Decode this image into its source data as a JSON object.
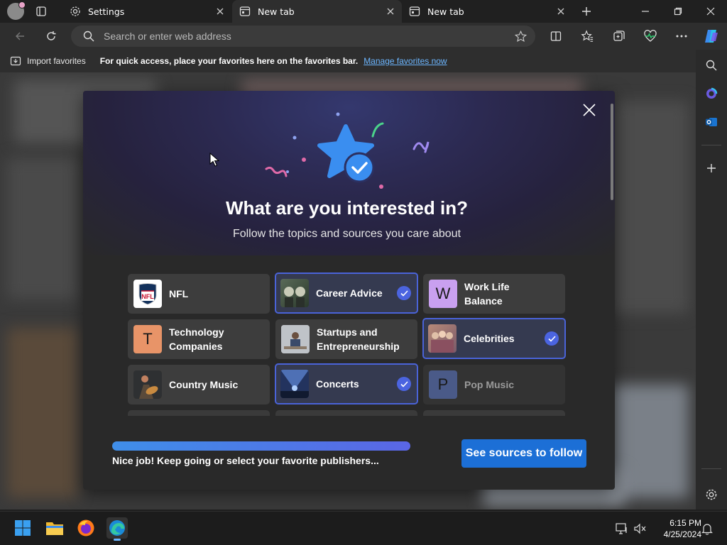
{
  "browser": {
    "tabs": [
      {
        "title": "Settings",
        "icon": "gear-icon",
        "active": false
      },
      {
        "title": "New tab",
        "icon": "newtab-page-icon",
        "active": true
      },
      {
        "title": "New tab",
        "icon": "newtab-page-icon",
        "active": false
      }
    ],
    "address": {
      "placeholder": "Search or enter web address",
      "value": ""
    },
    "favorites_bar": {
      "import_label": "Import favorites",
      "message": "For quick access, place your favorites here on the favorites bar.",
      "link": "Manage favorites now"
    }
  },
  "modal": {
    "title": "What are you interested in?",
    "subtitle": "Follow the topics and sources you care about",
    "topics": [
      {
        "label": "NFL",
        "thumb": "nfl-logo",
        "selected": false
      },
      {
        "label": "Career Advice",
        "thumb": "photo",
        "selected": true
      },
      {
        "label": "Work Life\nBalance",
        "thumb": "W",
        "selected": false
      },
      {
        "label": "Technology\nCompanies",
        "thumb": "T",
        "selected": false
      },
      {
        "label": "Startups and\nEntrepreneurship",
        "thumb": "photo",
        "selected": false
      },
      {
        "label": "Celebrities",
        "thumb": "photo",
        "selected": true
      },
      {
        "label": "Country Music",
        "thumb": "photo",
        "selected": false
      },
      {
        "label": "Concerts",
        "thumb": "photo",
        "selected": true
      },
      {
        "label": "Pop Music",
        "thumb": "P",
        "selected": false
      }
    ],
    "progress_fraction": 1.0,
    "progress_message": "Nice job! Keep going or select your favorite publishers...",
    "cta_label": "See sources to follow"
  },
  "taskbar": {
    "time": "6:15 PM",
    "date": "4/25/2024"
  },
  "colors": {
    "accent": "#1c6fd6",
    "selected_border": "#4a63d8",
    "check": "#4b64e0",
    "link": "#6cb6ff"
  }
}
